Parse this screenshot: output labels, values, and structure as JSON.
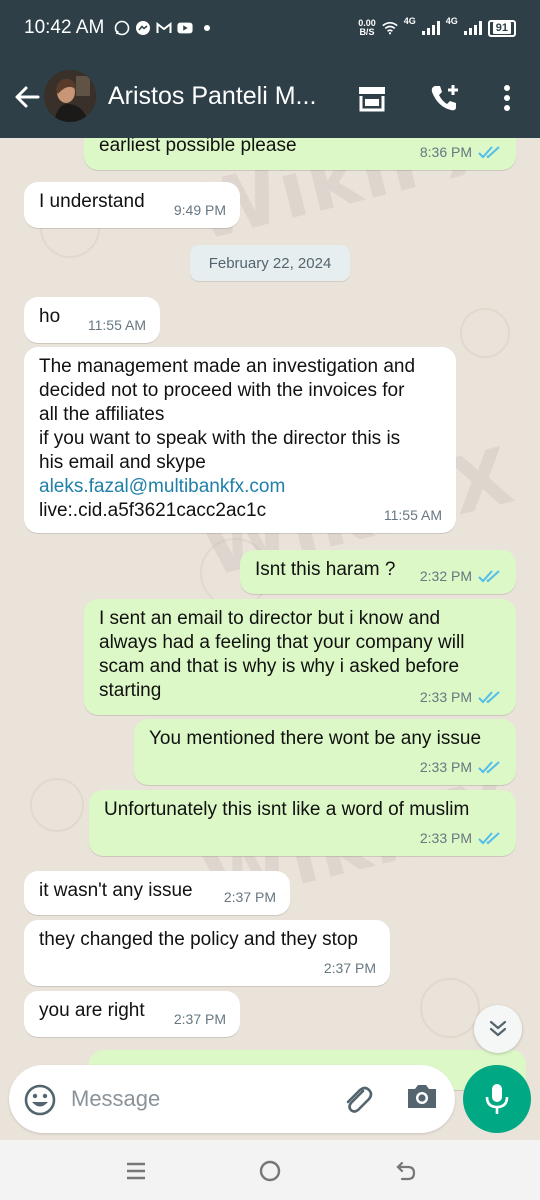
{
  "status_bar": {
    "time": "10:42 AM",
    "speed_value": "0.00",
    "speed_unit": "B/S",
    "network_1": "4G",
    "network_2": "4G",
    "battery": "91"
  },
  "header": {
    "contact_name": "Aristos Panteli M..."
  },
  "chat": {
    "date_separator": "February 22, 2024",
    "messages": [
      {
        "direction": "out",
        "text": "earliest possible please",
        "time": "8:36 PM",
        "status": "read"
      },
      {
        "direction": "in",
        "text": "I understand",
        "time": "9:49 PM"
      },
      {
        "direction": "in",
        "text": "ho",
        "time": "11:55 AM"
      },
      {
        "direction": "in",
        "text_lines": "The management made an investigation and\ndecided not to proceed with the invoices for\nall the affiliates\nif you want to speak with the director this is\nhis email and skype",
        "email": "aleks.fazal@multibankfx.com",
        "skype": "live:.cid.a5f3621cacc2ac1c",
        "time": "11:55 AM"
      },
      {
        "direction": "out",
        "text": "Isnt this haram ?",
        "time": "2:32 PM",
        "status": "read"
      },
      {
        "direction": "out",
        "text": "I sent an email to director but i know and\nalways had a feeling that your company will\nscam and that is why is why i asked before\nstarting",
        "time": "2:33 PM",
        "status": "read"
      },
      {
        "direction": "out",
        "text": "You mentioned there wont be any issue",
        "time": "2:33 PM",
        "status": "read"
      },
      {
        "direction": "out",
        "text": "Unfortunately this isnt like a word of muslim",
        "time": "2:33 PM",
        "status": "read"
      },
      {
        "direction": "in",
        "text": "it wasn't any issue",
        "time": "2:37 PM"
      },
      {
        "direction": "in",
        "text": "they changed the policy and they stop",
        "time": "2:37 PM"
      },
      {
        "direction": "in",
        "text": "you are right",
        "time": "2:37 PM"
      }
    ]
  },
  "composer": {
    "placeholder": "Message"
  },
  "watermark": "WikiFX",
  "colors": {
    "header_bg": "#2e3f48",
    "outgoing_bubble": "#dcf8c6",
    "incoming_bubble": "#ffffff",
    "chat_bg": "#eae3da",
    "read_ticks": "#53bdeb",
    "accent_green": "#00a884",
    "link": "#1f7fa8"
  },
  "icons": {
    "back": "arrow-left-icon",
    "store": "storefront-icon",
    "add_call": "phone-plus-icon",
    "menu": "more-vertical-icon",
    "emoji": "smiley-icon",
    "attach": "paperclip-icon",
    "camera": "camera-icon",
    "mic": "microphone-icon",
    "scroll": "double-chevron-down-icon"
  }
}
